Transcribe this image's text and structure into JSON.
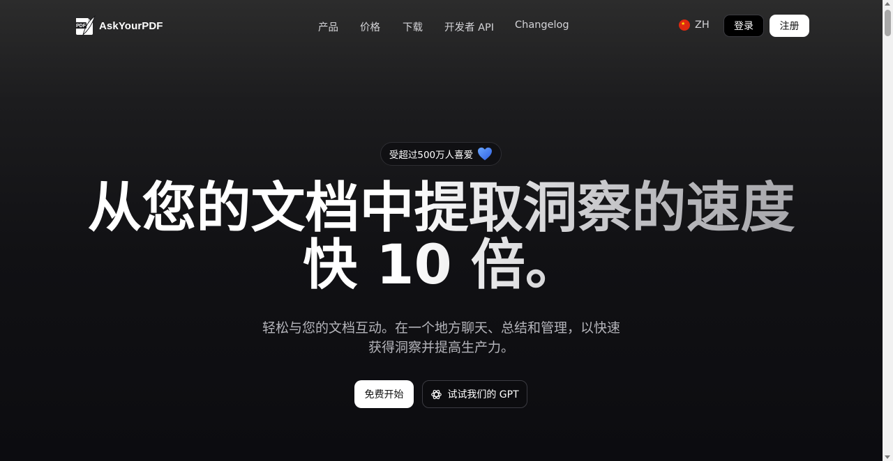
{
  "nav": {
    "logo_text": "AskYourPDF",
    "logo_badge": "PDF",
    "links": [
      "产品",
      "价格",
      "下载",
      "开发者 API",
      "Changelog"
    ],
    "language": "ZH",
    "login_label": "登录",
    "signup_label": "注册"
  },
  "hero": {
    "badge_text": "受超过500万人喜爱",
    "headline_line1": "从您的文档中提取洞察的速度",
    "headline_line2": "快 10 倍。",
    "subtitle_line1": "轻松与您的文档互动。在一个地方聊天、总结和管理，以快速",
    "subtitle_line2": "获得洞察并提高生产力。",
    "primary_button": "免费开始",
    "secondary_button": "试试我们的 GPT"
  },
  "colors": {
    "background": "#0c0c10",
    "accent_heart": "#3b82f6",
    "flag_red": "#de2910"
  },
  "icons": [
    "pdf-logo-icon",
    "china-flag-icon",
    "blue-heart-icon",
    "openai-gpt-icon"
  ]
}
